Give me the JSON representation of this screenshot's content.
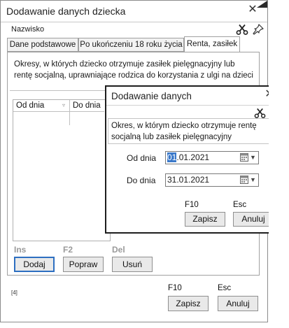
{
  "main_window": {
    "title": "Dodawanie danych dziecka",
    "close_glyph": "✕",
    "field_label": "Nazwisko",
    "tabs": [
      {
        "label": "Dane podstawowe",
        "active": false
      },
      {
        "label": "Po ukończeniu 18 roku życia",
        "active": false
      },
      {
        "label": "Renta, zasiłek",
        "active": true
      }
    ],
    "description": "Okresy, w których dziecko otrzymuje  zasiłek pielęgnacyjny lub rentę socjalną, uprawniające rodzica do korzystania z ulgi na dzieci",
    "grid": {
      "columns": [
        "Od dnia",
        "Do dnia"
      ]
    },
    "hotkeys": {
      "add": "Ins",
      "edit": "F2",
      "delete": "Del"
    },
    "buttons": {
      "add": "Dodaj",
      "edit": "Popraw",
      "delete": "Usuń"
    },
    "footnote": "[4]",
    "footer_hotkeys": {
      "save": "F10",
      "cancel": "Esc"
    },
    "footer_buttons": {
      "save": "Zapisz",
      "cancel": "Anuluj"
    }
  },
  "dialog": {
    "title": "Dodawanie danych",
    "close_glyph": "✕",
    "description": "Okres, w którym dziecko otrzymuje rentę socjalną lub zasiłek pielęgnacyjny",
    "from_label": "Od dnia",
    "from_value_selected": "01",
    "from_value_rest": ".01.2021",
    "to_label": "Do dnia",
    "to_value": "31.01.2021",
    "hotkeys": {
      "save": "F10",
      "cancel": "Esc"
    },
    "buttons": {
      "save": "Zapisz",
      "cancel": "Anuluj"
    }
  },
  "icons": {
    "pin": "pin-icon",
    "tools": "scissors-icon",
    "calendar": "calendar-icon",
    "dropdown": "chevron-down-icon"
  }
}
